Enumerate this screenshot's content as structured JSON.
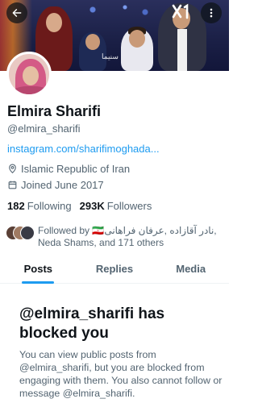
{
  "header": {
    "back_icon": "arrow-left-icon",
    "logo_label": "x1",
    "menu_icon": "kebab-menu-icon"
  },
  "banner": {
    "caption": "سنیما"
  },
  "profile": {
    "name": "Elmira Sharifi",
    "handle": "@elmira_sharifi",
    "link": "instagram.com/sharifimoghada...",
    "location": "Islamic Republic of Iran",
    "joined": "Joined June 2017",
    "following_count": "182",
    "following_label": "Following",
    "followers_count": "293K",
    "followers_label": "Followers",
    "followed_by": "Followed by ‎🇮🇷عرفان فراهانی‎, نادر آقازاده‎, Neda Shams, and 171 others"
  },
  "tabs": [
    {
      "label": "Posts",
      "active": true
    },
    {
      "label": "Replies",
      "active": false
    },
    {
      "label": "Media",
      "active": false
    }
  ],
  "blocked": {
    "title": "@elmira_sharifi has blocked you",
    "body": "You can view public posts from @elmira_sharifi, but you are blocked from engaging with them. You also cannot follow or message @elmira_sharifi."
  },
  "colors": {
    "accent": "#1d9bf0",
    "text_primary": "#0f1419",
    "text_secondary": "#536471"
  }
}
